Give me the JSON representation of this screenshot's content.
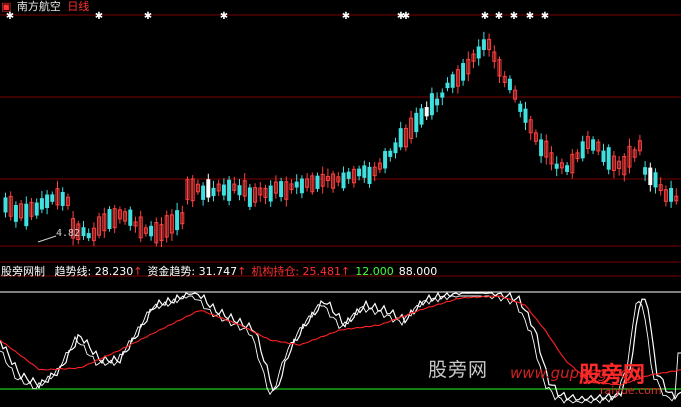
{
  "header": {
    "stock_name": "南方航空",
    "period": "日线",
    "chart_icon": "chart-icon"
  },
  "price_panel": {
    "low_label": "4.82",
    "up_candle_color": "#ff4040",
    "down_candle_color": "#40e0e0",
    "flat_candle_color": "#ffffff",
    "grid_color": "#7a0000",
    "signal_marker": "✱"
  },
  "indicator": {
    "name": "股旁网制",
    "items": [
      {
        "label": "趋势线:",
        "value": "28.230",
        "arrow": "↑",
        "label_color": "#ffffff",
        "value_color": "#ffffff"
      },
      {
        "label": "资金趋势:",
        "value": "31.747",
        "arrow": "↑",
        "label_color": "#ffffff",
        "value_color": "#ffffff"
      },
      {
        "label": "机构持仓:",
        "value": "25.481",
        "arrow": "↑",
        "label_color": "#ff3030",
        "value_color": "#ff3030"
      },
      {
        "label": "",
        "value": "12.000",
        "arrow": "",
        "label_color": "#40ff40",
        "value_color": "#40ff40"
      },
      {
        "label": "",
        "value": "88.000",
        "arrow": "",
        "label_color": "#ffffff",
        "value_color": "#ffffff"
      }
    ],
    "arrow_color": "#ff3030",
    "trend_color": "#ffffff",
    "capital_color": "#ffffff",
    "institution_color": "#ff2020",
    "low_line_color": "#20ff20",
    "high_line_color": "#ffffff"
  },
  "watermark": {
    "site_cn": "股旁网",
    "site_en": "www.gupang.com",
    "logo_text": "股旁网",
    "logo_url": "raiyue.com"
  }
}
